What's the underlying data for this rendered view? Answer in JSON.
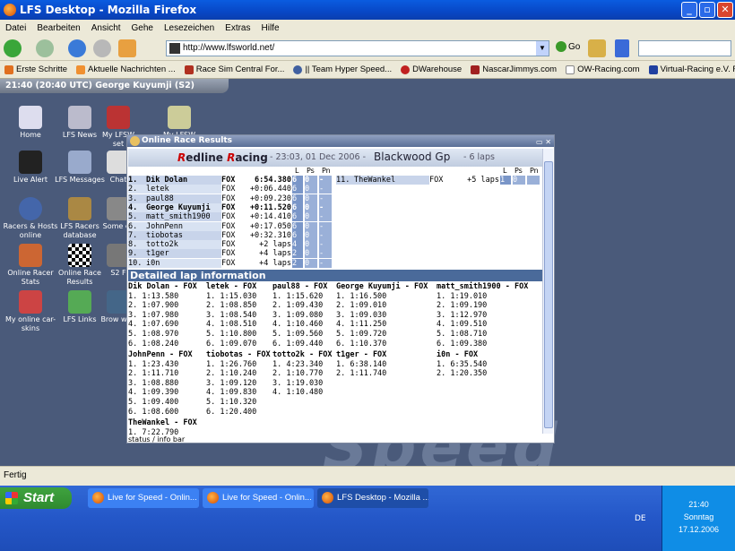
{
  "window": {
    "title": "LFS Desktop - Mozilla Firefox"
  },
  "menu": [
    "Datei",
    "Bearbeiten",
    "Ansicht",
    "Gehe",
    "Lesezeichen",
    "Extras",
    "Hilfe"
  ],
  "toolbar": {
    "url": "http://www.lfsworld.net/",
    "go_label": "Go"
  },
  "bookmarks": [
    "Erste Schritte",
    "Aktuelle Nachrichten ...",
    "Race Sim Central For...",
    "|| Team Hyper Speed...",
    "DWarehouse",
    "NascarJimmys.com",
    "OW-Racing.com",
    "Virtual-Racing e.V. Fo..."
  ],
  "lfsbar": "21:40 (20:40 UTC)  George Kuyumji (S2)",
  "desktop_icons": [
    {
      "label": "Home"
    },
    {
      "label": "LFS News"
    },
    {
      "label": "My LFSW set"
    },
    {
      "label": "My LFSW"
    },
    {
      "label": "Live Alert"
    },
    {
      "label": "LFS Messages"
    },
    {
      "label": "Chat"
    },
    {
      "label": "Racers & Hosts online"
    },
    {
      "label": "LFS Racers database"
    },
    {
      "label": "Some ch"
    },
    {
      "label": "Online Racer Stats"
    },
    {
      "label": "Online Race Results"
    },
    {
      "label": "S2 F"
    },
    {
      "label": "My online car-skins"
    },
    {
      "label": "LFS Links"
    },
    {
      "label": "Brow web"
    }
  ],
  "popup": {
    "title": "Online Race Results",
    "team_a": "R",
    "team_b": "edline ",
    "team_c": "R",
    "team_d": "acing",
    "date": "- 23:03, 01 Dec 2006 -",
    "track": "Blackwood Gp",
    "laps": "- 6 laps",
    "col_l": "L",
    "col_ps": "Ps",
    "col_pn": "Pn",
    "results": [
      {
        "pos": "1.",
        "name": "Dik Dolan",
        "car": "FOX",
        "time": "6:54.380",
        "l": "6",
        "ps": "0",
        "pn": "-"
      },
      {
        "pos": "2.",
        "name": "letek",
        "car": "FOX",
        "time": "+0:06.440",
        "l": "6",
        "ps": "0",
        "pn": "-"
      },
      {
        "pos": "3.",
        "name": "paul88",
        "car": "FOX",
        "time": "+0:09.230",
        "l": "6",
        "ps": "0",
        "pn": "-"
      },
      {
        "pos": "4.",
        "name": "George Kuyumji",
        "car": "FOX",
        "time": "+0:11.520",
        "l": "6",
        "ps": "0",
        "pn": "-"
      },
      {
        "pos": "5.",
        "name": "matt_smith1900",
        "car": "FOX",
        "time": "+0:14.410",
        "l": "6",
        "ps": "0",
        "pn": "-"
      },
      {
        "pos": "6.",
        "name": "JohnPenn",
        "car": "FOX",
        "time": "+0:17.050",
        "l": "6",
        "ps": "0",
        "pn": "-"
      },
      {
        "pos": "7.",
        "name": "tiobotas",
        "car": "FOX",
        "time": "+0:32.310",
        "l": "6",
        "ps": "0",
        "pn": "-"
      },
      {
        "pos": "8.",
        "name": "totto2k",
        "car": "FOX",
        "time": "+2 laps",
        "l": "4",
        "ps": "0",
        "pn": "-"
      },
      {
        "pos": "9.",
        "name": "t1ger",
        "car": "FOX",
        "time": "+4 laps",
        "l": "2",
        "ps": "0",
        "pn": "-"
      },
      {
        "pos": "10.",
        "name": "i0n",
        "car": "FOX",
        "time": "+4 laps",
        "l": "2",
        "ps": "0",
        "pn": "-"
      }
    ],
    "results_right": [
      {
        "pos": "11.",
        "name": "TheWankel",
        "car": "FOX",
        "time": "+5 laps",
        "l": "1",
        "ps": "0",
        "pn": ""
      }
    ],
    "detail_title": "Detailed lap information",
    "details": [
      {
        "name": "Dik Dolan - FOX",
        "laps": [
          "1. 1:13.580",
          "2. 1:07.900",
          "3. 1:07.980",
          "4. 1:07.690",
          "5. 1:08.970",
          "6. 1:08.240"
        ]
      },
      {
        "name": "letek - FOX",
        "laps": [
          "1. 1:15.030",
          "2. 1:08.850",
          "3. 1:08.540",
          "4. 1:08.510",
          "5. 1:10.800",
          "6. 1:09.070"
        ]
      },
      {
        "name": "paul88 - FOX",
        "laps": [
          "1. 1:15.620",
          "2. 1:09.430",
          "3. 1:09.080",
          "4. 1:10.460",
          "5. 1:09.560",
          "6. 1:09.440"
        ]
      },
      {
        "name": "George Kuyumji - FOX",
        "laps": [
          "1. 1:16.500",
          "2. 1:09.010",
          "3. 1:09.030",
          "4. 1:11.250",
          "5. 1:09.720",
          "6. 1:10.370"
        ]
      },
      {
        "name": "matt_smith1900 - FOX",
        "laps": [
          "1. 1:19.010",
          "2. 1:09.190",
          "3. 1:12.970",
          "4. 1:09.510",
          "5. 1:08.710",
          "6. 1:09.380"
        ]
      },
      {
        "name": "JohnPenn - FOX",
        "laps": [
          "1. 1:23.430",
          "2. 1:11.710",
          "3. 1:08.880",
          "4. 1:09.390",
          "5. 1:09.400",
          "6. 1:08.600"
        ]
      },
      {
        "name": "tiobotas - FOX",
        "laps": [
          "1. 1:26.760",
          "2. 1:10.240",
          "3. 1:09.120",
          "4. 1:09.830",
          "5. 1:10.320",
          "6. 1:20.400"
        ]
      },
      {
        "name": "totto2k - FOX",
        "laps": [
          "1. 4:23.340",
          "2. 1:10.770",
          "3. 1:19.030",
          "4. 1:10.480"
        ]
      },
      {
        "name": "t1ger - FOX",
        "laps": [
          "1. 6:38.140",
          "2. 1:11.740"
        ]
      },
      {
        "name": "i0n - FOX",
        "laps": [
          "1. 6:35.540",
          "2. 1:20.350"
        ]
      },
      {
        "name": "TheWankel - FOX",
        "laps": [
          "1. 7:22.790"
        ]
      }
    ],
    "status": "status / info bar"
  },
  "ffstatus": "Fertig",
  "taskbar": {
    "start": "Start",
    "tasks": [
      "Live for Speed - Onlin...",
      "Live for Speed - Onlin...",
      "LFS Desktop - Mozilla ..."
    ],
    "lang": "DE",
    "time": "21:40",
    "day": "Sonntag",
    "date": "17.12.2006"
  }
}
